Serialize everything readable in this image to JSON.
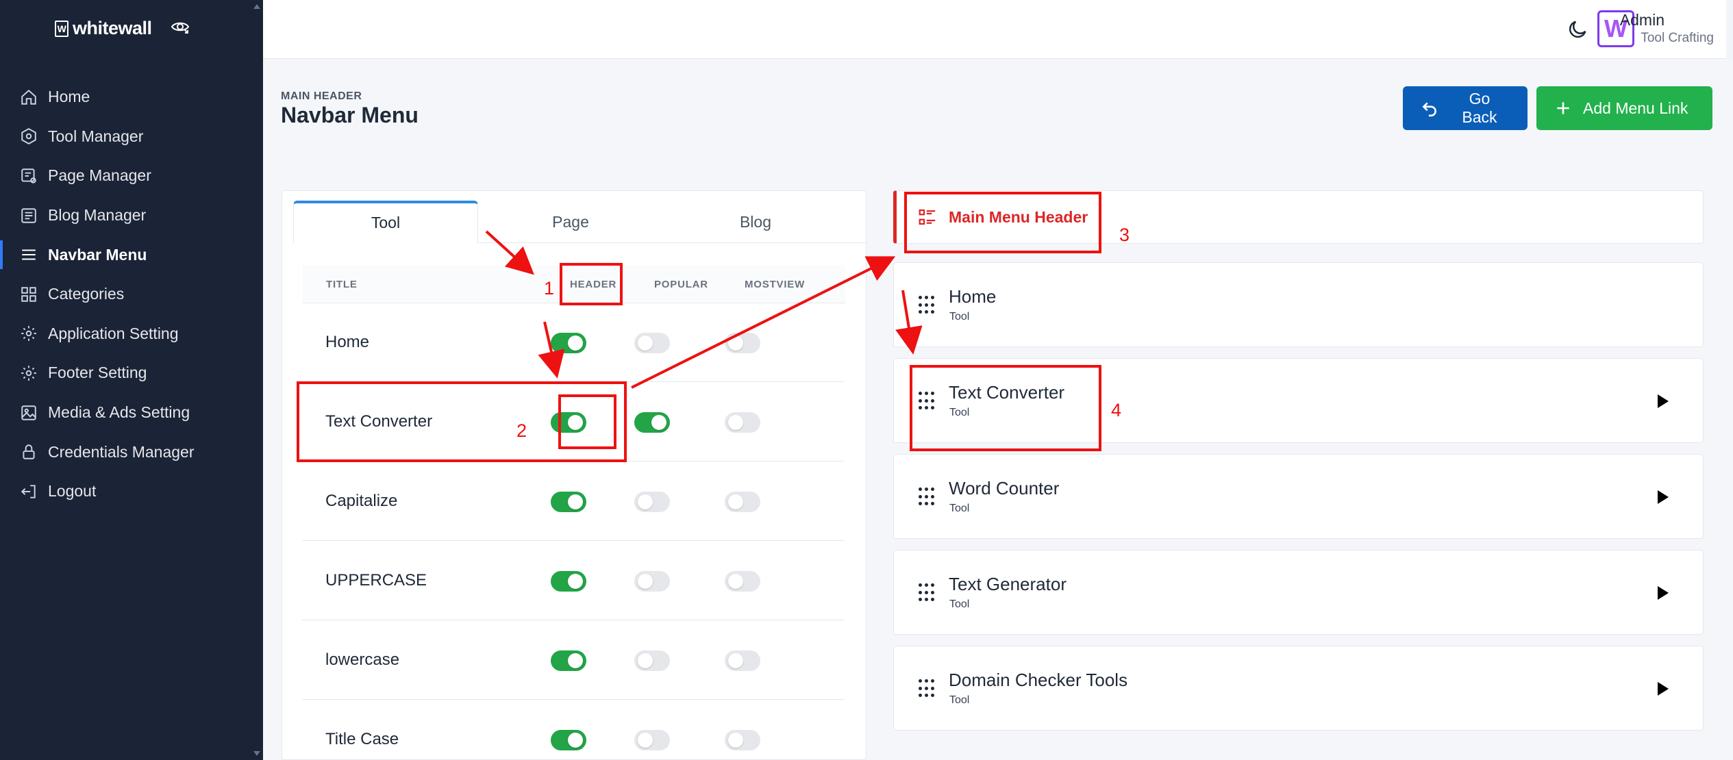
{
  "sidebar": {
    "brand": "whitewall",
    "items": [
      {
        "label": "Home",
        "icon": "home-icon"
      },
      {
        "label": "Tool Manager",
        "icon": "hexagon-icon"
      },
      {
        "label": "Page Manager",
        "icon": "page-settings-icon"
      },
      {
        "label": "Blog Manager",
        "icon": "blog-icon"
      },
      {
        "label": "Navbar Menu",
        "icon": "menu-icon",
        "active": true
      },
      {
        "label": "Categories",
        "icon": "grid-icon"
      },
      {
        "label": "Application Setting",
        "icon": "gear-icon"
      },
      {
        "label": "Footer Setting",
        "icon": "gear-icon"
      },
      {
        "label": "Media & Ads Setting",
        "icon": "image-icon"
      },
      {
        "label": "Credentials Manager",
        "icon": "lock-icon"
      },
      {
        "label": "Logout",
        "icon": "logout-icon"
      }
    ]
  },
  "topbar": {
    "avatar_letter": "W",
    "user_name": "Admin",
    "user_role": "Tool Crafting"
  },
  "header": {
    "kicker": "MAIN HEADER",
    "title": "Navbar Menu",
    "back_label": "Go Back",
    "add_label": "Add Menu Link"
  },
  "left_panel": {
    "tabs": [
      {
        "label": "Tool",
        "active": true
      },
      {
        "label": "Page",
        "active": false
      },
      {
        "label": "Blog",
        "active": false
      }
    ],
    "columns": [
      "TITLE",
      "HEADER",
      "POPULAR",
      "MOSTVIEW"
    ],
    "rows": [
      {
        "title": "Home",
        "header": true,
        "popular": false,
        "mostview": false
      },
      {
        "title": "Text Converter",
        "header": true,
        "popular": true,
        "mostview": false
      },
      {
        "title": "Capitalize",
        "header": true,
        "popular": false,
        "mostview": false
      },
      {
        "title": "UPPERCASE",
        "header": true,
        "popular": false,
        "mostview": false
      },
      {
        "title": "lowercase",
        "header": true,
        "popular": false,
        "mostview": false
      },
      {
        "title": "Title Case",
        "header": true,
        "popular": false,
        "mostview": false
      }
    ]
  },
  "right_panel": {
    "header_label": "Main Menu Header",
    "items": [
      {
        "title": "Home",
        "type": "Tool",
        "expandable": false
      },
      {
        "title": "Text Converter",
        "type": "Tool",
        "expandable": true
      },
      {
        "title": "Word Counter",
        "type": "Tool",
        "expandable": true
      },
      {
        "title": "Text Generator",
        "type": "Tool",
        "expandable": true
      },
      {
        "title": "Domain Checker Tools",
        "type": "Tool",
        "expandable": true
      }
    ]
  },
  "annotations": {
    "color": "#ee1111",
    "labels": [
      "1",
      "2",
      "3",
      "4"
    ]
  }
}
